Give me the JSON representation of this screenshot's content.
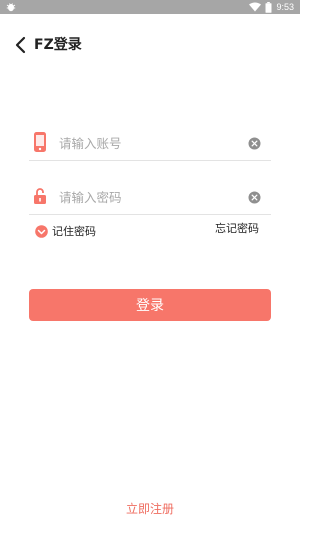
{
  "status_bar": {
    "time": "9:53",
    "icons": [
      "debug-bug-icon",
      "wifi-icon",
      "battery-icon"
    ],
    "background": "#a6a6a6"
  },
  "header": {
    "back_icon": "chevron-left-icon",
    "title": "FZ登录"
  },
  "form": {
    "account": {
      "icon": "phone-icon",
      "placeholder": "请输入账号",
      "value": "",
      "clear_icon": "clear-circle-icon"
    },
    "password": {
      "icon": "lock-icon",
      "placeholder": "请输入密码",
      "value": "",
      "clear_icon": "clear-circle-icon"
    },
    "remember_label": "记住密码",
    "remember_checked": true,
    "forgot_label": "忘记密码"
  },
  "login_button": {
    "label": "登录"
  },
  "register_link": {
    "label": "立即注册"
  },
  "colors": {
    "accent": "#f7766a",
    "accent_text": "#ef6d60",
    "divider": "#e3e3e3",
    "placeholder": "#a8a8a8"
  }
}
